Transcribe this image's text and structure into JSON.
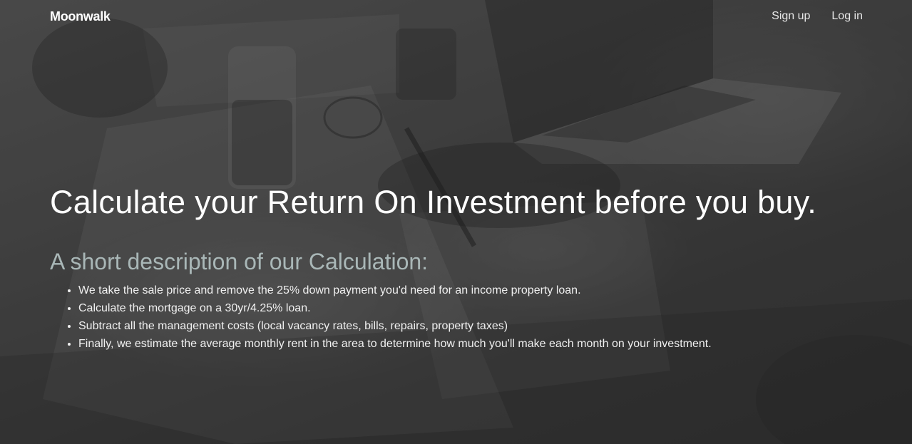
{
  "navbar": {
    "brand": "Moonwalk",
    "links": [
      {
        "label": "Sign up"
      },
      {
        "label": "Log in"
      }
    ]
  },
  "hero": {
    "headline": "Calculate your Return On Investment before you buy.",
    "subheadline": "A short description of our Calculation:",
    "steps": [
      "We take the sale price and remove the 25% down payment you'd need for an income property loan.",
      "Calculate the mortgage on a 30yr/4.25% loan.",
      "Subtract all the management costs (local vacancy rates, bills, repairs, property taxes)",
      "Finally, we estimate the average monthly rent in the area to determine how much you'll make each month on your investment."
    ]
  },
  "colors": {
    "subheadline": "#a9b7b7",
    "text": "#ffffff"
  }
}
